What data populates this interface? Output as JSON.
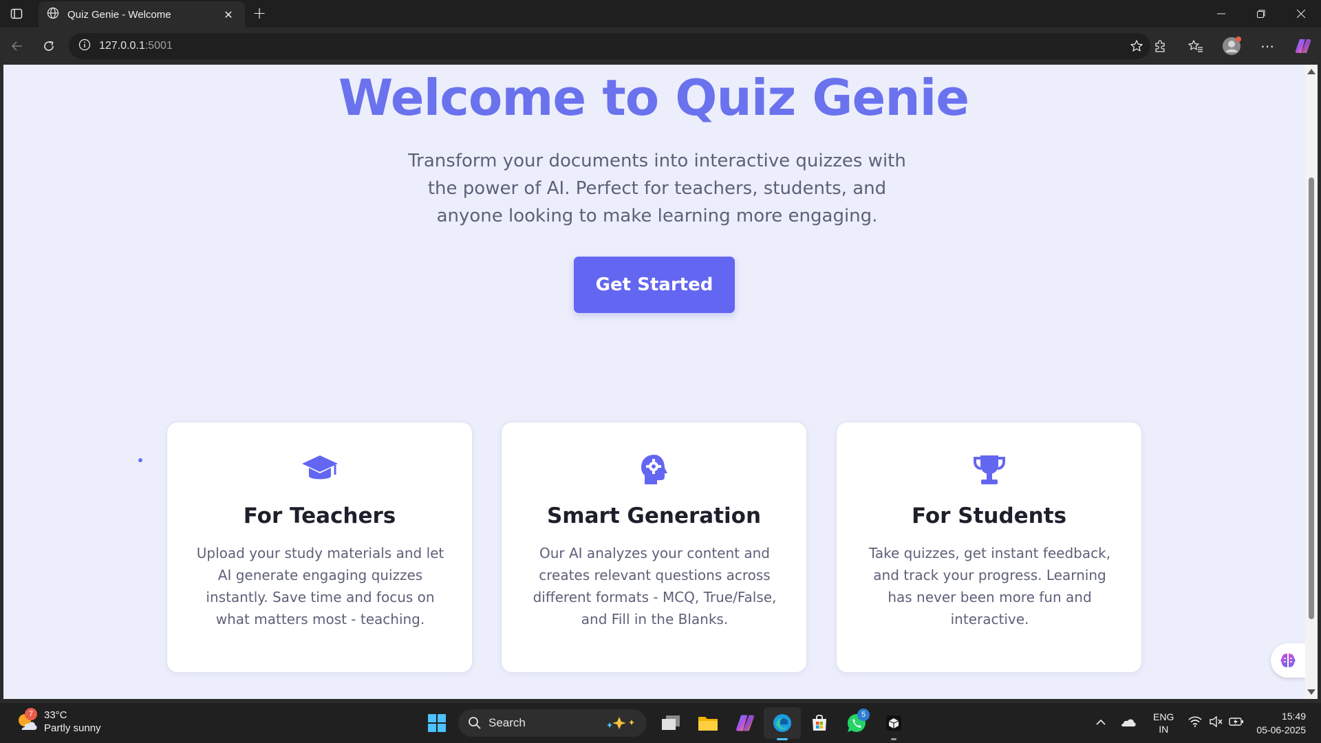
{
  "browser": {
    "tab_title": "Quiz Genie - Welcome",
    "url_host": "127.0.0.1",
    "url_port": ":5001"
  },
  "hero": {
    "title": "Welcome to Quiz Genie",
    "subtitle": "Transform your documents into interactive quizzes with the power of AI. Perfect for teachers, students, and anyone looking to make learning more engaging.",
    "cta_label": "Get Started"
  },
  "features": [
    {
      "icon": "graduation-cap-icon",
      "title": "For Teachers",
      "text": "Upload your study materials and let AI generate engaging quizzes instantly. Save time and focus on what matters most - teaching."
    },
    {
      "icon": "brain-gear-icon",
      "title": "Smart Generation",
      "text": "Our AI analyzes your content and creates relevant questions across different formats - MCQ, True/False, and Fill in the Blanks."
    },
    {
      "icon": "trophy-icon",
      "title": "For Students",
      "text": "Take quizzes, get instant feedback, and track your progress. Learning has never been more fun and interactive."
    }
  ],
  "colors": {
    "accent": "#6366f1",
    "title": "#6a72ee",
    "page_bg": "#eceefb"
  },
  "taskbar": {
    "weather_badge": "7",
    "temperature": "33°C",
    "weather_desc": "Partly sunny",
    "search_label": "Search",
    "whatsapp_badge": "5",
    "lang_line1": "ENG",
    "lang_line2": "IN",
    "time": "15:49",
    "date": "05-06-2025"
  }
}
